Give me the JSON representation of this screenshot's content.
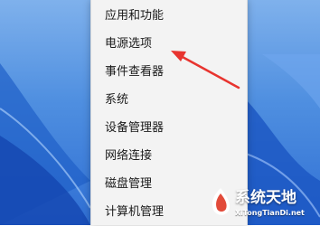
{
  "menu": {
    "items": [
      {
        "label": "应用和功能"
      },
      {
        "label": "电源选项"
      },
      {
        "label": "事件查看器"
      },
      {
        "label": "系统"
      },
      {
        "label": "设备管理器"
      },
      {
        "label": "网络连接"
      },
      {
        "label": "磁盘管理"
      },
      {
        "label": "计算机管理"
      }
    ]
  },
  "annotation": {
    "arrow_color": "#e8342f",
    "points_to": "电源选项"
  },
  "watermark": {
    "text": "系统天地",
    "url": "XiTongTianDi.net"
  },
  "colors": {
    "menu_bg": "#f3f3f3",
    "wallpaper": "#3a7bd9"
  }
}
